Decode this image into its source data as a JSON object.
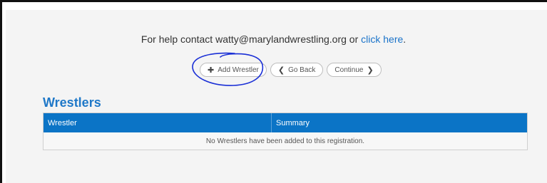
{
  "help": {
    "prefix": "For help contact watty@marylandwrestling.org or ",
    "link": "click here",
    "suffix": "."
  },
  "buttons": {
    "add_wrestler": "Add Wrestler",
    "go_back": "Go Back",
    "continue": "Continue"
  },
  "section": {
    "title": "Wrestlers"
  },
  "table": {
    "columns": [
      "Wrestler",
      "Summary"
    ],
    "empty_message": "No Wrestlers have been added to this registration."
  },
  "colors": {
    "accent": "#0b74c6",
    "link": "#1a73c9",
    "annotation": "#1a2fd6"
  }
}
